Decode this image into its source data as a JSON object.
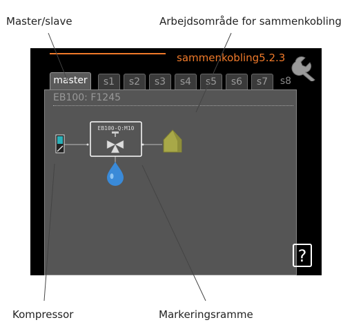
{
  "callouts": {
    "master_slave": "Master/slave",
    "work_area": "Arbejdsområde for sammenkobling",
    "compressor": "Kompressor",
    "marking_frame": "Markeringsramme"
  },
  "screen": {
    "title": "sammenkobling5.2.3",
    "tabs": [
      "master",
      "s1",
      "s2",
      "s3",
      "s4",
      "s5",
      "s6",
      "s7",
      "s8"
    ],
    "active_tab": "master",
    "panel_header": "EB100: F1245",
    "valve_label": "EB100-Q:M10",
    "help_label": "?"
  },
  "icons": {
    "settings": "wrench-icon",
    "compressor": "compressor-icon",
    "valve": "valve-icon",
    "house": "house-icon",
    "water": "water-drop-icon",
    "help": "help-icon"
  },
  "colors": {
    "accent": "#f07a2a",
    "screen_bg": "#000000",
    "panel_bg": "#555555",
    "compressor": "#2ab0b8",
    "water": "#3a8ad8",
    "house": "#a8a848"
  }
}
